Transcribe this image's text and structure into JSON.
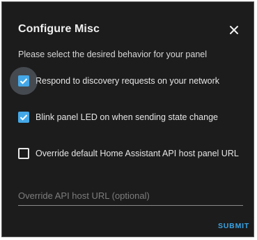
{
  "dialog": {
    "title": "Configure Misc",
    "close_icon": "close-icon",
    "subtitle": "Please select the desired behavior for your panel",
    "options": [
      {
        "label": "Respond to discovery requests on your network",
        "checked": true
      },
      {
        "label": "Blink panel LED on when sending state change",
        "checked": true
      },
      {
        "label": "Override default Home Assistant API host panel URL",
        "checked": false
      }
    ],
    "api_host_field": {
      "value": "",
      "placeholder": "Override API host URL (optional)"
    },
    "submit_label": "SUBMIT"
  },
  "colors": {
    "background": "#1c1c1c",
    "accent": "#44a8e8",
    "text": "#e6e6e6"
  }
}
